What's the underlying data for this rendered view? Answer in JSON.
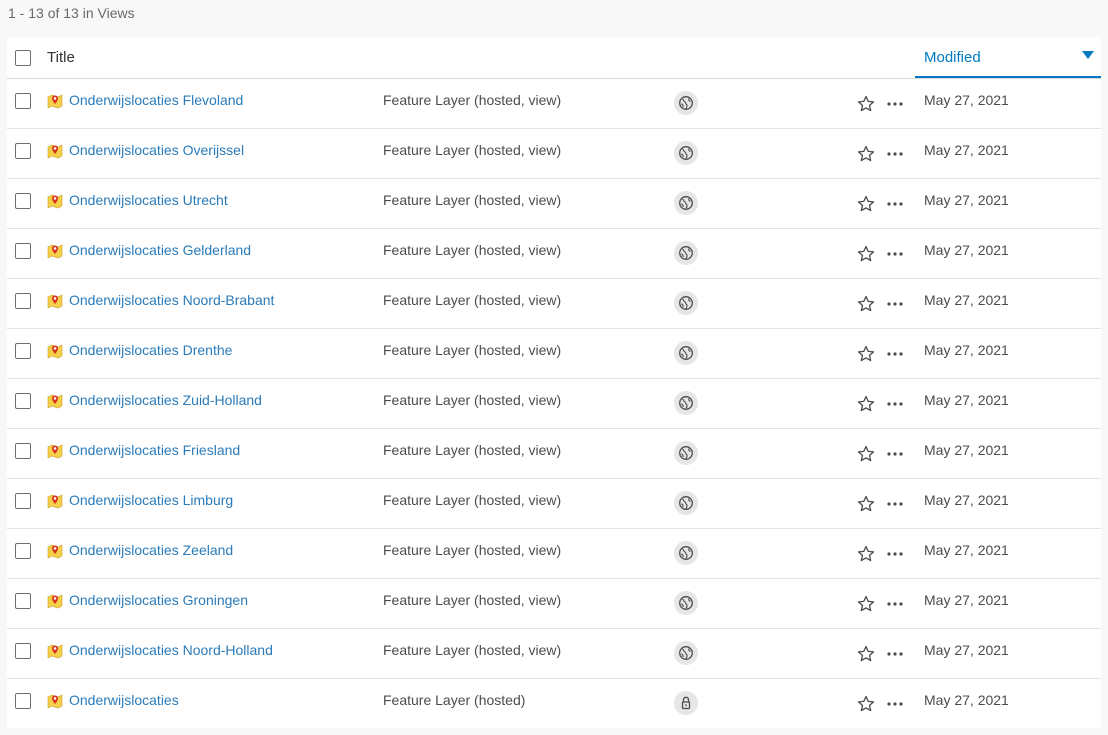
{
  "results_count": "1 - 13 of 13 in Views",
  "header": {
    "title_label": "Title",
    "modified_label": "Modified",
    "sort_direction": "descending"
  },
  "colors": {
    "link": "#2b7bb9",
    "accent": "#007ac2",
    "layer_icon_yellow": "#f5d04a",
    "layer_icon_red": "#d83020"
  },
  "items": [
    {
      "title": "Onderwijslocaties Flevoland",
      "type": "Feature Layer (hosted, view)",
      "sharing": "public",
      "modified": "May 27, 2021"
    },
    {
      "title": "Onderwijslocaties Overijssel",
      "type": "Feature Layer (hosted, view)",
      "sharing": "public",
      "modified": "May 27, 2021"
    },
    {
      "title": "Onderwijslocaties Utrecht",
      "type": "Feature Layer (hosted, view)",
      "sharing": "public",
      "modified": "May 27, 2021"
    },
    {
      "title": "Onderwijslocaties Gelderland",
      "type": "Feature Layer (hosted, view)",
      "sharing": "public",
      "modified": "May 27, 2021"
    },
    {
      "title": "Onderwijslocaties Noord-Brabant",
      "type": "Feature Layer (hosted, view)",
      "sharing": "public",
      "modified": "May 27, 2021"
    },
    {
      "title": "Onderwijslocaties Drenthe",
      "type": "Feature Layer (hosted, view)",
      "sharing": "public",
      "modified": "May 27, 2021"
    },
    {
      "title": "Onderwijslocaties Zuid-Holland",
      "type": "Feature Layer (hosted, view)",
      "sharing": "public",
      "modified": "May 27, 2021"
    },
    {
      "title": "Onderwijslocaties Friesland",
      "type": "Feature Layer (hosted, view)",
      "sharing": "public",
      "modified": "May 27, 2021"
    },
    {
      "title": "Onderwijslocaties Limburg",
      "type": "Feature Layer (hosted, view)",
      "sharing": "public",
      "modified": "May 27, 2021"
    },
    {
      "title": "Onderwijslocaties Zeeland",
      "type": "Feature Layer (hosted, view)",
      "sharing": "public",
      "modified": "May 27, 2021"
    },
    {
      "title": "Onderwijslocaties Groningen",
      "type": "Feature Layer (hosted, view)",
      "sharing": "public",
      "modified": "May 27, 2021"
    },
    {
      "title": "Onderwijslocaties Noord-Holland",
      "type": "Feature Layer (hosted, view)",
      "sharing": "public",
      "modified": "May 27, 2021"
    },
    {
      "title": "Onderwijslocaties",
      "type": "Feature Layer (hosted)",
      "sharing": "private",
      "modified": "May 27, 2021"
    }
  ]
}
